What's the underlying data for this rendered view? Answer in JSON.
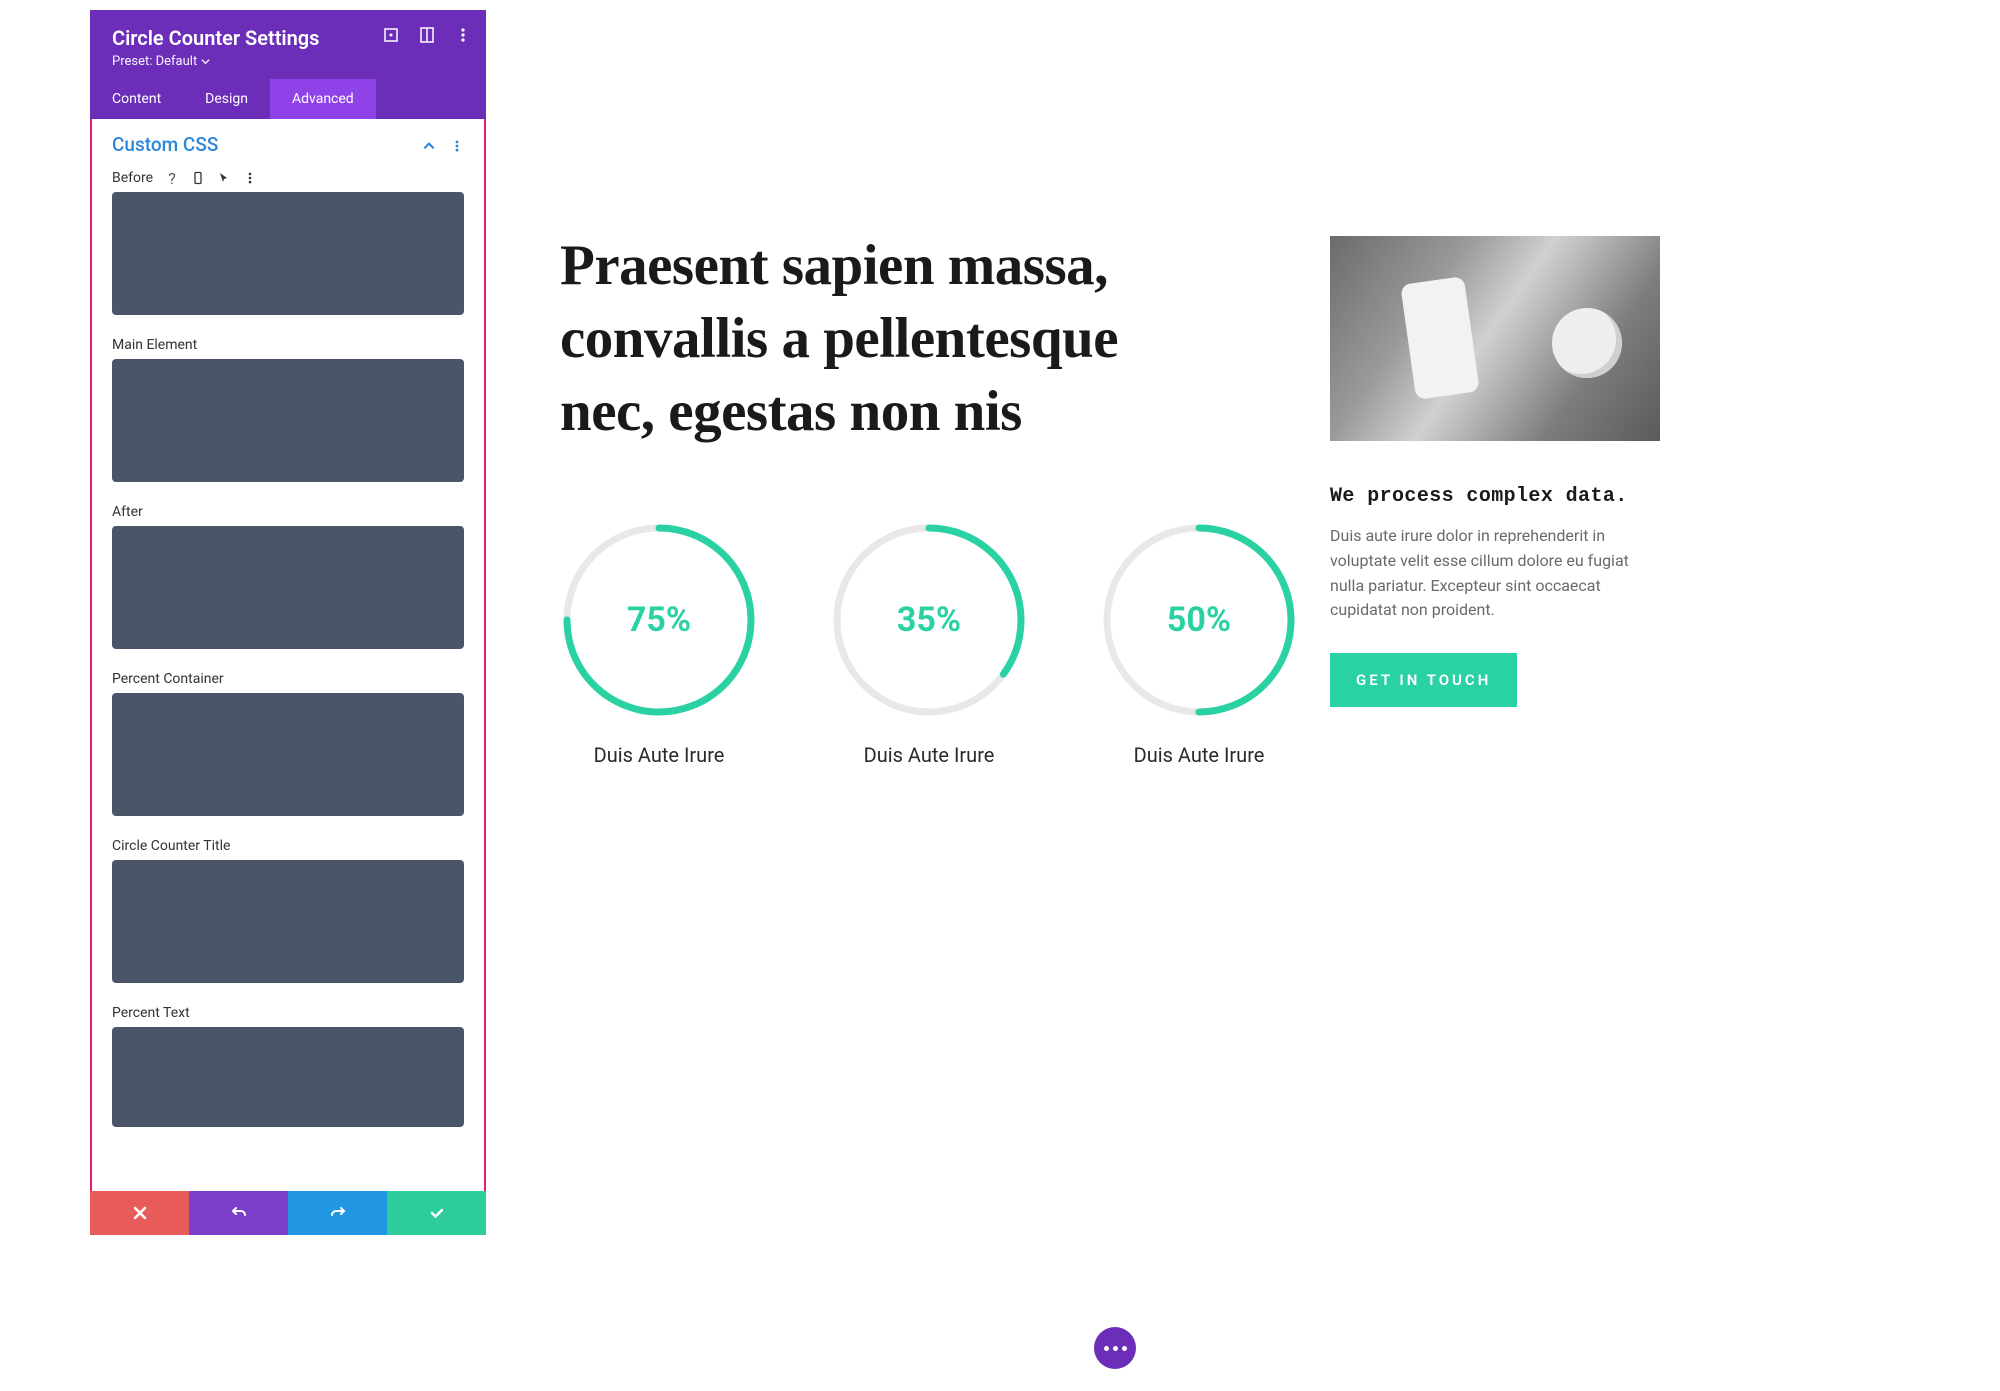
{
  "panel": {
    "title": "Circle Counter Settings",
    "preset_label": "Preset: Default",
    "tabs": {
      "content": "Content",
      "design": "Design",
      "advanced": "Advanced"
    },
    "section_title": "Custom CSS",
    "fields": {
      "before": "Before",
      "main_element": "Main Element",
      "after": "After",
      "percent_container": "Percent Container",
      "circle_counter_title": "Circle Counter Title",
      "percent_text": "Percent Text"
    }
  },
  "page": {
    "hero": "Praesent sapien massa, convallis a pellentesque nec, egestas non nis",
    "counter_label": "Duis Aute Irure",
    "side_title": "We process complex data.",
    "side_text": "Duis aute irure dolor in reprehenderit in voluptate velit esse cillum dolore eu fugiat nulla pariatur. Excepteur sint occaecat cupidatat non proident.",
    "cta": "GET IN TOUCH"
  },
  "chart_data": [
    {
      "type": "pie",
      "title": "Duis Aute Irure",
      "value": 75,
      "display": "75%",
      "max": 100,
      "color": "#2ad2a3"
    },
    {
      "type": "pie",
      "title": "Duis Aute Irure",
      "value": 35,
      "display": "35%",
      "max": 100,
      "color": "#2ad2a3"
    },
    {
      "type": "pie",
      "title": "Duis Aute Irure",
      "value": 50,
      "display": "50%",
      "max": 100,
      "color": "#2ad2a3"
    }
  ]
}
